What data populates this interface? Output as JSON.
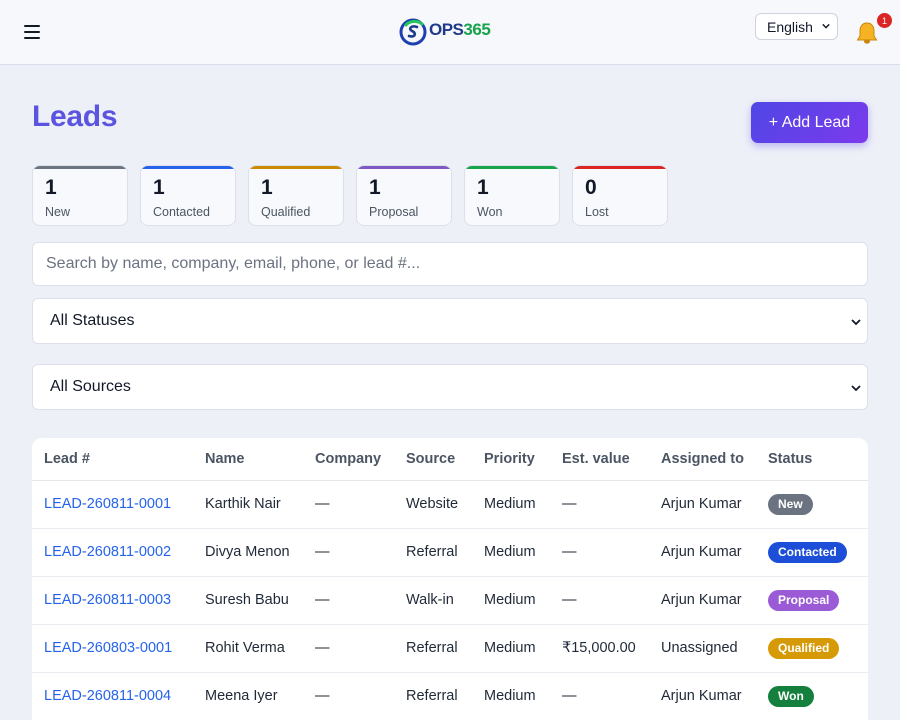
{
  "header": {
    "menu_icon": "hamburger-icon",
    "logo_text_a": "OPS",
    "logo_text_b": "365",
    "language": "English",
    "notification_count": "1",
    "bell_icon": "bell-icon"
  },
  "page": {
    "title": "Leads",
    "add_button": "+ Add Lead"
  },
  "stats": [
    {
      "value": "1",
      "label": "New",
      "color": "#6b7280"
    },
    {
      "value": "1",
      "label": "Contacted",
      "color": "#2563eb"
    },
    {
      "value": "1",
      "label": "Qualified",
      "color": "#ca8a04"
    },
    {
      "value": "1",
      "label": "Proposal",
      "color": "#7e57c2"
    },
    {
      "value": "1",
      "label": "Won",
      "color": "#16a34a"
    },
    {
      "value": "0",
      "label": "Lost",
      "color": "#dc2626"
    }
  ],
  "filters": {
    "search_placeholder": "Search by name, company, email, phone, or lead #...",
    "status_value": "All Statuses",
    "source_value": "All Sources"
  },
  "table": {
    "headers": [
      "Lead #",
      "Name",
      "Company",
      "Source",
      "Priority",
      "Est. value",
      "Assigned to",
      "Status"
    ],
    "rows": [
      {
        "lead": "LEAD-260811-0001",
        "name": "Karthik Nair",
        "company": "—",
        "source": "Website",
        "priority": "Medium",
        "value": "—",
        "assigned": "Arjun Kumar",
        "status": "New",
        "status_color": "#6b7280"
      },
      {
        "lead": "LEAD-260811-0002",
        "name": "Divya Menon",
        "company": "—",
        "source": "Referral",
        "priority": "Medium",
        "value": "—",
        "assigned": "Arjun Kumar",
        "status": "Contacted",
        "status_color": "#1d4ed8"
      },
      {
        "lead": "LEAD-260811-0003",
        "name": "Suresh Babu",
        "company": "—",
        "source": "Walk-in",
        "priority": "Medium",
        "value": "—",
        "assigned": "Arjun Kumar",
        "status": "Proposal",
        "status_color": "#9b5bd6"
      },
      {
        "lead": "LEAD-260803-0001",
        "name": "Rohit Verma",
        "company": "—",
        "source": "Referral",
        "priority": "Medium",
        "value": "₹15,000.00",
        "assigned": "Unassigned",
        "status": "Qualified",
        "status_color": "#d69a06"
      },
      {
        "lead": "LEAD-260811-0004",
        "name": "Meena Iyer",
        "company": "—",
        "source": "Referral",
        "priority": "Medium",
        "value": "—",
        "assigned": "Arjun Kumar",
        "status": "Won",
        "status_color": "#15803d"
      }
    ]
  }
}
